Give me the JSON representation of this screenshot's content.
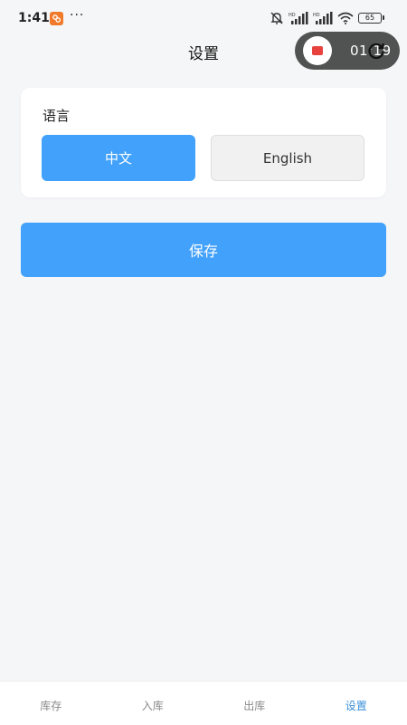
{
  "status_bar": {
    "time": "1:41",
    "app_badge_icon": "app-notification-icon",
    "dots": "···",
    "battery": "65",
    "icons": [
      "mute-icon",
      "hd-signal-icon",
      "hd-signal-icon",
      "wifi-icon",
      "battery-icon"
    ]
  },
  "header": {
    "title": "设置"
  },
  "recorder": {
    "time": "01:19",
    "stop_color": "#e8423f"
  },
  "language": {
    "label": "语言",
    "options": [
      "中文",
      "English"
    ],
    "selected": "中文"
  },
  "save_label": "保存",
  "tabs": {
    "inventory": "库存",
    "inbound": "入库",
    "outbound": "出库",
    "settings": "设置",
    "active": "设置"
  },
  "colors": {
    "primary": "#42a1fb",
    "active_tab": "#3a8fd8",
    "background": "#f5f6f8"
  }
}
